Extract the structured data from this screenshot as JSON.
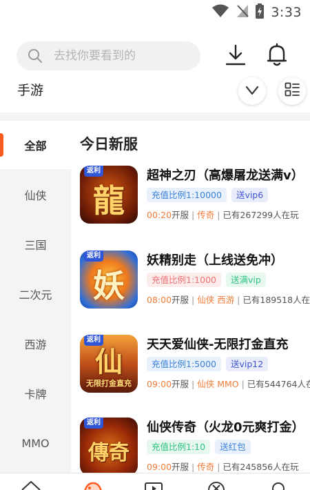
{
  "status": {
    "time": "3:33"
  },
  "search": {
    "placeholder": "去找你要看到的"
  },
  "category_title": "手游",
  "sidebar": {
    "items": [
      {
        "label": "全部"
      },
      {
        "label": "仙侠"
      },
      {
        "label": "三国"
      },
      {
        "label": "二次元"
      },
      {
        "label": "西游"
      },
      {
        "label": "卡牌"
      },
      {
        "label": "MMO"
      }
    ]
  },
  "section_title": "今日新服",
  "games": [
    {
      "name": "超神之刃（高爆屠龙送满v）",
      "icon_tag": "返利",
      "icon_glyph": "龍",
      "badges": [
        {
          "text": "充值比例1:10000",
          "style": "blue"
        },
        {
          "text": "送vip6",
          "style": "navy"
        }
      ],
      "time": "00:20",
      "open_label": "开服",
      "categories": "传奇",
      "players": "已有267299人在玩"
    },
    {
      "name": "妖精别走（上线送免冲）",
      "icon_tag": "返利",
      "icon_glyph": "妖",
      "badges": [
        {
          "text": "充值比例1:1000",
          "style": "red"
        },
        {
          "text": "送满vip",
          "style": "green"
        }
      ],
      "time": "08:00",
      "open_label": "开服",
      "categories": "仙侠 西游",
      "players": "已有189518人在玩"
    },
    {
      "name": "天天爱仙侠-无限打金直充",
      "icon_tag": "返利",
      "icon_glyph": "仙",
      "icon_banner": "无限打金直充",
      "badges": [
        {
          "text": "充值比例1:5000",
          "style": "blue"
        },
        {
          "text": "送vip12",
          "style": "navy"
        }
      ],
      "time": "09:00",
      "open_label": "开服",
      "categories": "仙侠 MMO",
      "players": "已有544764人在玩"
    },
    {
      "name": "仙侠传奇（火龙0元爽打金）",
      "icon_tag": "返利",
      "icon_glyph": "傳奇",
      "badges": [
        {
          "text": "充值比例1:10",
          "style": "green"
        },
        {
          "text": "送红包",
          "style": "blue"
        }
      ],
      "time": "09:00",
      "open_label": "开服",
      "categories": "传奇",
      "players": "已有245856人在玩"
    }
  ],
  "colors": {
    "accent": "#ff5a1f",
    "orange_text": "#f07d3b"
  }
}
